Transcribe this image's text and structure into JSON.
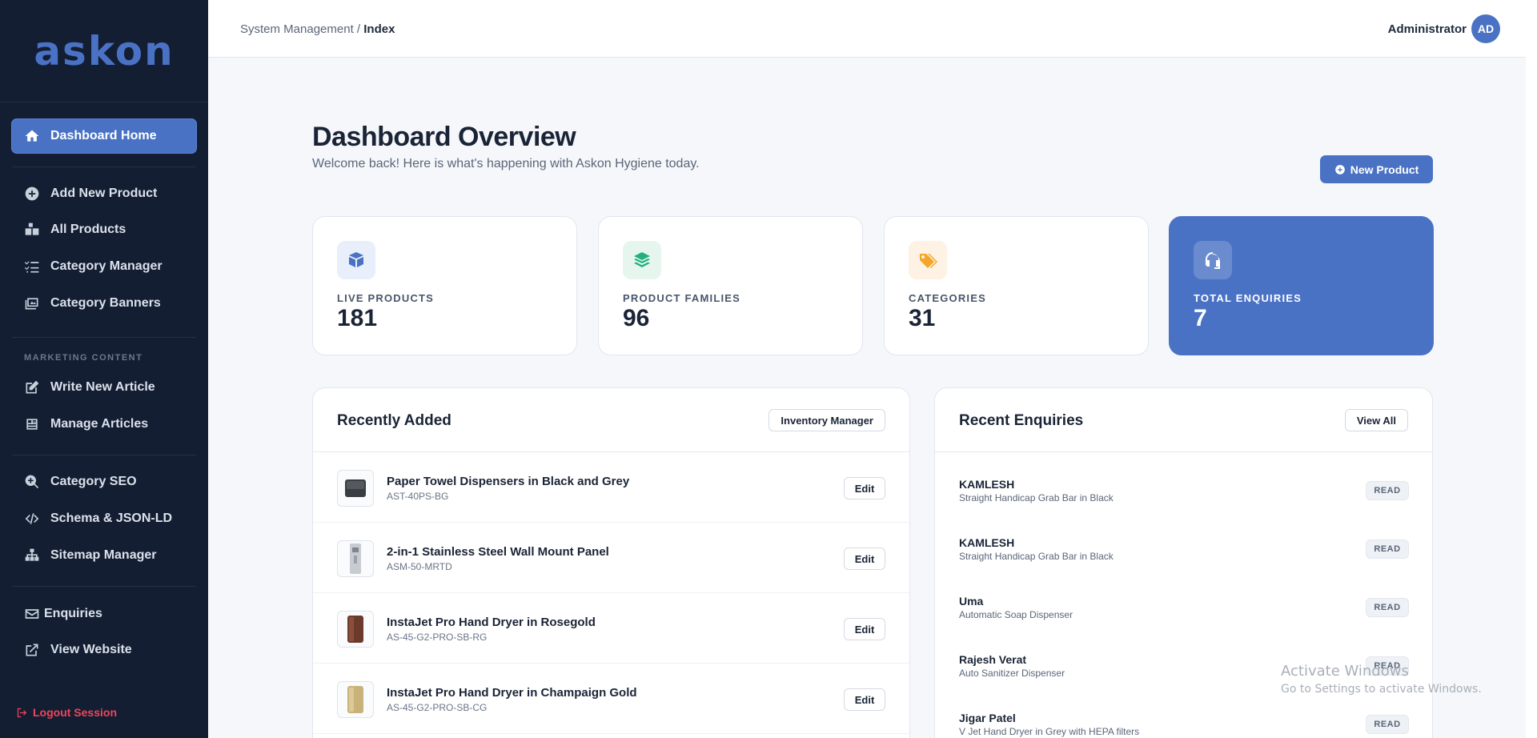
{
  "brand": {
    "name": "askon"
  },
  "sidebar": {
    "items": [
      {
        "label": "Dashboard Home"
      },
      {
        "label": "Add New Product"
      },
      {
        "label": "All Products"
      },
      {
        "label": "Category Manager"
      },
      {
        "label": "Category Banners"
      },
      {
        "label": "Write New Article"
      },
      {
        "label": "Manage Articles"
      },
      {
        "label": "Category SEO"
      },
      {
        "label": "Schema & JSON-LD"
      },
      {
        "label": "Sitemap Manager"
      },
      {
        "label": "Enquiries"
      },
      {
        "label": "View Website"
      }
    ],
    "section_marketing": "MARKETING CONTENT",
    "logout": "Logout Session"
  },
  "header": {
    "breadcrumb_parent": "System Management",
    "breadcrumb_sep": " / ",
    "breadcrumb_current": "Index",
    "user_name": "Administrator",
    "avatar_initials": "AD"
  },
  "main": {
    "title": "Dashboard Overview",
    "subtitle": "Welcome back! Here is what's happening with Askon Hygiene today.",
    "new_product_label": "New Product"
  },
  "stats": [
    {
      "label": "LIVE PRODUCTS",
      "value": "181",
      "icon": "box-icon",
      "color": "#4a72c4"
    },
    {
      "label": "PRODUCT FAMILIES",
      "value": "96",
      "icon": "layers-icon",
      "color": "#22b07d"
    },
    {
      "label": "CATEGORIES",
      "value": "31",
      "icon": "tags-icon",
      "color": "#f4a62a"
    },
    {
      "label": "TOTAL ENQUIRIES",
      "value": "7",
      "icon": "headset-icon",
      "color": "#ffffff"
    }
  ],
  "recent_added": {
    "title": "Recently Added",
    "button": "Inventory Manager",
    "edit_label": "Edit",
    "items": [
      {
        "name": "Paper Towel Dispensers in Black and Grey",
        "sku": "AST-40PS-BG"
      },
      {
        "name": "2-in-1 Stainless Steel Wall Mount Panel",
        "sku": "ASM-50-MRTD"
      },
      {
        "name": "InstaJet Pro Hand Dryer in Rosegold",
        "sku": "AS-45-G2-PRO-SB-RG"
      },
      {
        "name": "InstaJet Pro Hand Dryer in Champaign Gold",
        "sku": "AS-45-G2-PRO-SB-CG"
      }
    ]
  },
  "recent_enquiries": {
    "title": "Recent Enquiries",
    "button": "View All",
    "items": [
      {
        "name": "KAMLESH",
        "product": "Straight Handicap Grab Bar in Black",
        "status": "READ"
      },
      {
        "name": "KAMLESH",
        "product": "Straight Handicap Grab Bar in Black",
        "status": "READ"
      },
      {
        "name": "Uma",
        "product": "Automatic Soap Dispenser",
        "status": "READ"
      },
      {
        "name": "Rajesh Verat",
        "product": "Auto Sanitizer Dispenser",
        "status": "READ"
      },
      {
        "name": "Jigar Patel",
        "product": "V Jet Hand Dryer in Grey with HEPA filters",
        "status": "READ"
      }
    ]
  },
  "watermark": {
    "line1": "Activate Windows",
    "line2": "Go to Settings to activate Windows."
  }
}
